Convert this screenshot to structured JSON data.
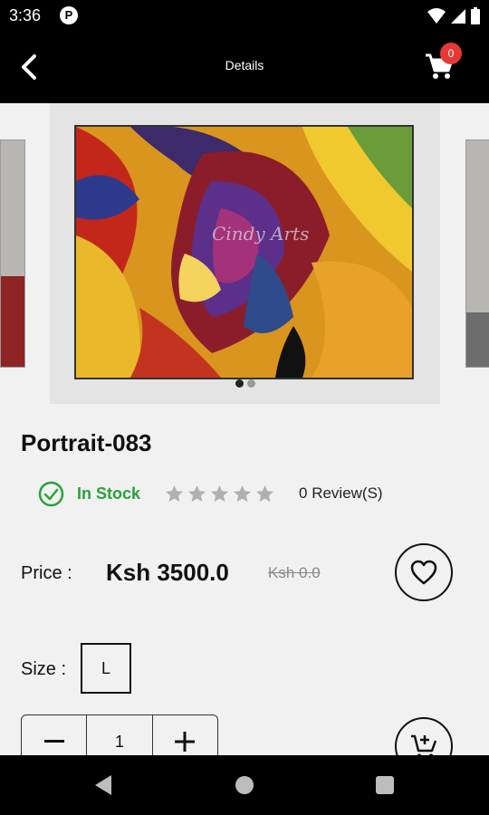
{
  "status_bar": {
    "time": "3:36",
    "app_icon_letter": "P"
  },
  "app_bar": {
    "title": "Details",
    "cart_count": "0"
  },
  "product": {
    "name": "Portrait-083",
    "stock_status": "In Stock",
    "rating_stars": 5,
    "rating_value": 0,
    "reviews": "0 Review(S)",
    "price_label": "Price :",
    "price": "Ksh 3500.0",
    "old_price": "Ksh 0.0",
    "size_label": "Size :",
    "size": "L",
    "quantity": "1",
    "watermark": "Cindy Arts"
  },
  "carousel": {
    "slides": 2,
    "active": 0
  },
  "icons": {
    "back": "arrow-back-icon",
    "cart": "shopping-cart-icon",
    "stock": "check-circle-icon",
    "wishlist": "heart-outline-icon",
    "add_to_cart": "cart-plus-icon",
    "minus": "minus-icon",
    "plus": "plus-icon"
  },
  "colors": {
    "bar_background": "#000000",
    "stock_green": "#2aa13a",
    "badge_red": "#e53935",
    "page_background": "#f1f1f1"
  }
}
